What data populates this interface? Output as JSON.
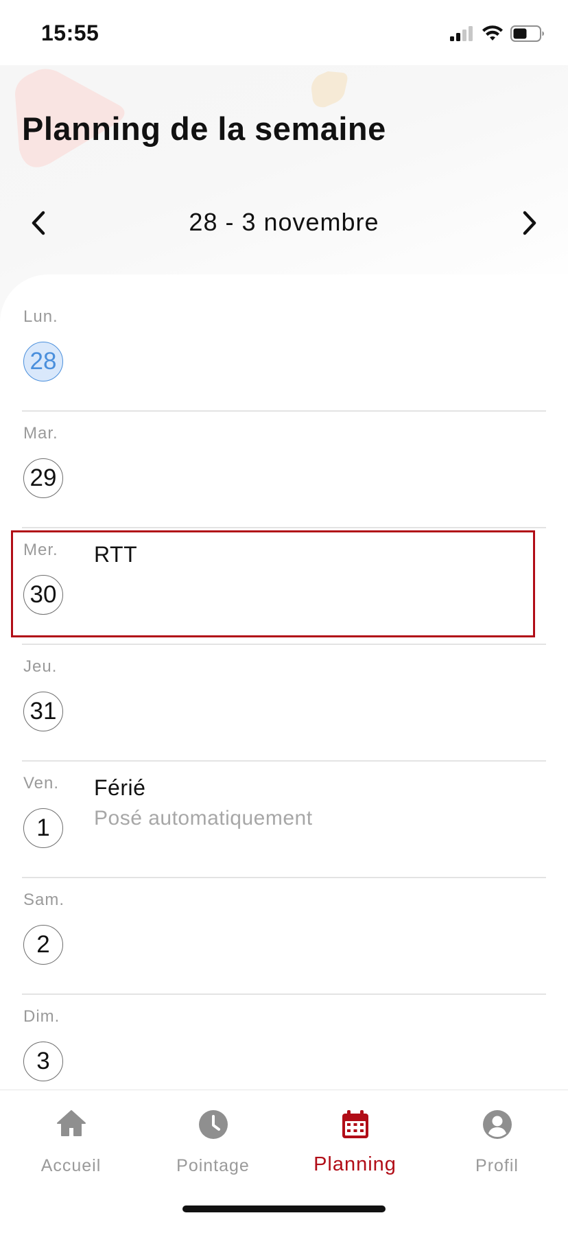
{
  "status_bar": {
    "time": "15:55"
  },
  "header": {
    "title": "Planning de la semaine",
    "week_range": "28 - 3 novembre"
  },
  "days": [
    {
      "abbr": "Lun.",
      "num": "28",
      "today": true
    },
    {
      "abbr": "Mar.",
      "num": "29"
    },
    {
      "abbr": "Mer.",
      "num": "30",
      "event": "RTT"
    },
    {
      "abbr": "Jeu.",
      "num": "31"
    },
    {
      "abbr": "Ven.",
      "num": "1",
      "event": "Férié",
      "event_sub": "Posé automatiquement"
    },
    {
      "abbr": "Sam.",
      "num": "2"
    },
    {
      "abbr": "Dim.",
      "num": "3"
    }
  ],
  "tabs": [
    {
      "label": "Accueil",
      "icon": "home-icon"
    },
    {
      "label": "Pointage",
      "icon": "clock-icon"
    },
    {
      "label": "Planning",
      "icon": "calendar-icon",
      "active": true
    },
    {
      "label": "Profil",
      "icon": "user-icon"
    }
  ],
  "colors": {
    "accent": "#b10d17",
    "today_fill": "#d9e8fb",
    "today_text": "#4a8fdc",
    "muted": "#9a9a9a"
  }
}
